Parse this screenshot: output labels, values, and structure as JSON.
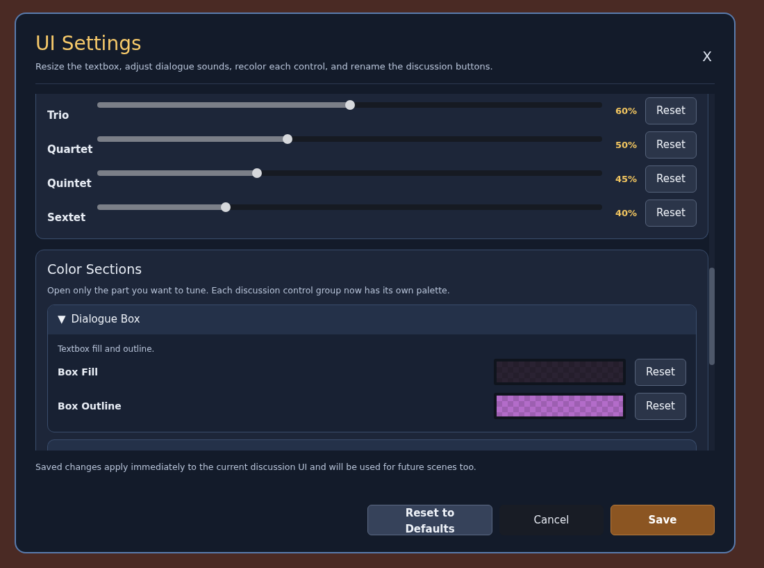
{
  "dialog": {
    "title": "UI Settings",
    "subtitle": "Resize the textbox, adjust dialogue sounds, recolor each control, and rename the discussion buttons.",
    "close": "X"
  },
  "sliders": [
    {
      "label": "Trio",
      "level": 0.5,
      "reading": "60%",
      "button": "Reset"
    },
    {
      "label": "Quartet",
      "level": 0.377,
      "reading": "50%",
      "button": "Reset"
    },
    {
      "label": "Quintet",
      "level": 0.316,
      "reading": "45%",
      "button": "Reset"
    },
    {
      "label": "Sextet",
      "level": 0.255,
      "reading": "40%",
      "button": "Reset"
    }
  ],
  "color_sections": {
    "title": "Color Sections",
    "description": "Open only the part you want to tune. Each discussion control group now has its own palette.",
    "groups": [
      {
        "marker": "▼",
        "title": "Dialogue Box",
        "expanded": true,
        "description": "Textbox fill and outline.",
        "colors": [
          {
            "label": "Box Fill",
            "color": "#2a2232",
            "button": "Reset"
          },
          {
            "label": "Box Outline",
            "color": "#b36cc9",
            "button": "Reset"
          }
        ]
      }
    ]
  },
  "footer_note": "Saved changes apply immediately to the current discussion UI and will be used for future scenes too.",
  "buttons": [
    {
      "label": "Reset to Defaults",
      "kind": "secondary"
    },
    {
      "label": "Cancel",
      "kind": "plain"
    },
    {
      "label": "Save",
      "kind": "primary"
    }
  ]
}
